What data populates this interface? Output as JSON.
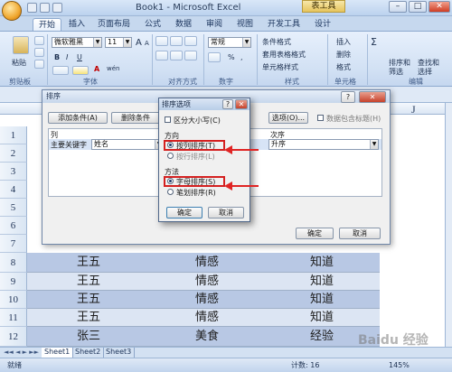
{
  "window": {
    "title": "Book1 - Microsoft Excel",
    "context_tab": "表工具",
    "controls": {
      "minimize": "–",
      "maximize": "□",
      "close": "✕"
    }
  },
  "tabs": [
    "开始",
    "插入",
    "页面布局",
    "公式",
    "数据",
    "审阅",
    "视图",
    "开发工具",
    "设计"
  ],
  "ribbon": {
    "clipboard": {
      "paste": "粘贴",
      "label": "剪贴板"
    },
    "font": {
      "name": "微软雅黑",
      "size": "11",
      "label": "字体",
      "bold": "B",
      "italic": "I",
      "underline": "U",
      "grow": "A",
      "shrink": "A",
      "wen": "wén",
      "font_color": "A"
    },
    "alignment": {
      "label": "对齐方式"
    },
    "number": {
      "format": "常规",
      "label": "数字",
      "currency": "%",
      "comma": ","
    },
    "styles": {
      "items": [
        "条件格式",
        "套用表格格式",
        "单元格样式"
      ],
      "label": "样式"
    },
    "cells": {
      "items": [
        "插入",
        "删除",
        "格式"
      ],
      "label": "单元格"
    },
    "editing": {
      "sigma": "Σ",
      "sort": "排序和\n筛选",
      "sort_line1": "排序和",
      "sort_line2": "筛选",
      "find_line1": "查找和",
      "find_line2": "选择",
      "label": "编辑"
    }
  },
  "grid": {
    "column_header_j": "J",
    "row_numbers": [
      "1",
      "2",
      "3",
      "4",
      "5",
      "6",
      "7",
      "8",
      "9",
      "10",
      "11",
      "12"
    ],
    "visible_rows": [
      {
        "num": "8",
        "a": "王五",
        "b": "情感",
        "c": "知道"
      },
      {
        "num": "9",
        "a": "王五",
        "b": "情感",
        "c": "知道"
      },
      {
        "num": "10",
        "a": "王五",
        "b": "情感",
        "c": "知道"
      },
      {
        "num": "11",
        "a": "王五",
        "b": "情感",
        "c": "知道"
      },
      {
        "num": "12",
        "a": "张三",
        "b": "美食",
        "c": "经验"
      }
    ]
  },
  "sheets": [
    "Sheet1",
    "Sheet2",
    "Sheet3"
  ],
  "status": {
    "ready": "就绪",
    "count": "计数: 16",
    "zoom": "145%"
  },
  "sort_dialog": {
    "title": "排序",
    "help": "?",
    "close": "✕",
    "add_level": "添加条件(A)",
    "delete_level": "删除条件",
    "options": "选项(O)...",
    "header_checkbox": "数据包含标题(H)",
    "col_header": "列",
    "order_header": "次序",
    "primary_key": "主要关键字",
    "primary_value": "姓名",
    "order_value": "升序",
    "ok": "确定",
    "cancel": "取消"
  },
  "options_dialog": {
    "title": "排序选项",
    "help": "?",
    "close": "✕",
    "case_sensitive": "区分大小写(C)",
    "direction_label": "方向",
    "by_column": "按列排序(T)",
    "by_row": "按行排序(L)",
    "method_label": "方法",
    "by_letter": "字母排序(S)",
    "by_stroke": "笔划排序(R)",
    "ok": "确定",
    "cancel": "取消"
  },
  "watermark": "Baidu 经验"
}
